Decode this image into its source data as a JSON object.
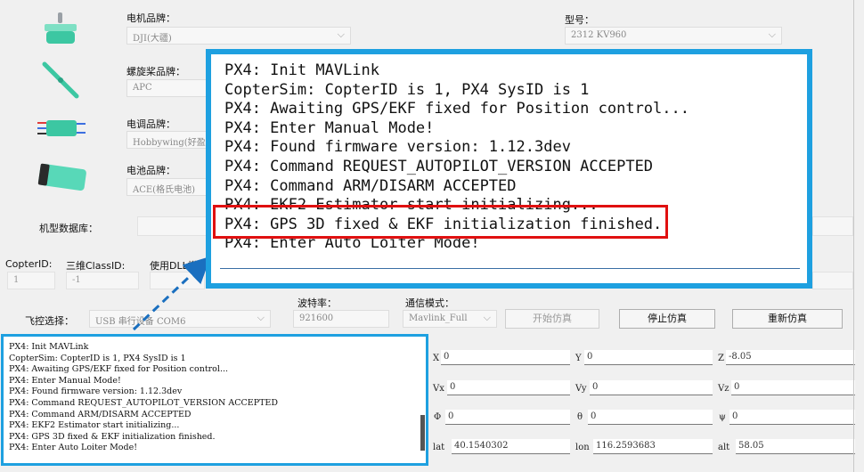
{
  "motor": {
    "label": "电机品牌：",
    "value": "DJI(大疆)"
  },
  "model": {
    "label": "型号：",
    "value": "2312 KV960"
  },
  "propeller": {
    "label": "螺旋桨品牌：",
    "value": "APC"
  },
  "esc": {
    "label": "电调品牌：",
    "value": "Hobbywing(好盈)"
  },
  "battery": {
    "label": "电池品牌：",
    "value": "ACE(格氏电池)"
  },
  "database": {
    "label": "机型数据库："
  },
  "ids": {
    "copter_id_label": "CopterID:",
    "copter_id_value": "1",
    "class_id_label": "三维ClassID:",
    "class_id_value": "-1",
    "dll_label": "使用DLL模型"
  },
  "flight_ctrl": {
    "label": "飞控选择：",
    "value": "USB 串行设备 COM6"
  },
  "baud": {
    "label": "波特率：",
    "value": "921600"
  },
  "comm": {
    "label": "通信模式：",
    "value": "Mavlink_Full"
  },
  "buttons": {
    "start": "开始仿真",
    "stop": "停止仿真",
    "restart": "重新仿真"
  },
  "coords": {
    "x_label": "X",
    "x": "0",
    "y_label": "Y",
    "y": "0",
    "z_label": "Z",
    "z": "-8.05",
    "vx_label": "Vx",
    "vx": "0",
    "vy_label": "Vy",
    "vy": "0",
    "vz_label": "Vz",
    "vz": "0",
    "phi_label": "Φ",
    "phi": "0",
    "theta_label": "θ",
    "theta": "0",
    "psi_label": "ψ",
    "psi": "0",
    "lat_label": "lat",
    "lat": "40.1540302",
    "lon_label": "lon",
    "lon": "116.2593683",
    "alt_label": "alt",
    "alt": "58.05"
  },
  "console": {
    "lines": [
      "PX4: Init MAVLink",
      "CopterSim: CopterID is 1, PX4 SysID is 1",
      "PX4: Awaiting GPS/EKF fixed for Position control...",
      "PX4: Enter Manual Mode!",
      "PX4: Found firmware version: 1.12.3dev",
      "PX4: Command REQUEST_AUTOPILOT_VERSION ACCEPTED",
      "PX4: Command ARM/DISARM ACCEPTED",
      "PX4: EKF2 Estimator start initializing...",
      "PX4: GPS 3D fixed & EKF initialization finished.",
      "PX4: Enter Auto Loiter Mode!"
    ],
    "highlighted_index": 8
  },
  "colors": {
    "callout_border": "#1ea0e0",
    "highlight_border": "#e01010",
    "arrow": "#1a6fbf"
  },
  "icons": [
    "motor-icon",
    "propeller-icon",
    "esc-icon",
    "battery-icon"
  ]
}
